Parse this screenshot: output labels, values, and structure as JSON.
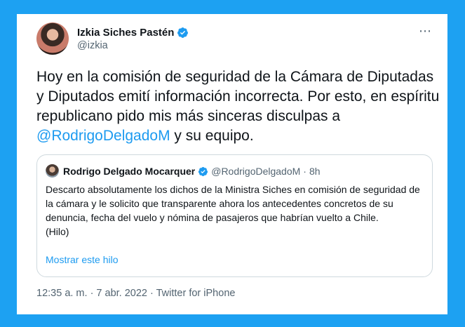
{
  "tweet": {
    "author": {
      "name": "Izkia Siches Pastén",
      "handle": "@izkia",
      "verified": true
    },
    "more_icon": "⋯",
    "text_parts": {
      "before": "Hoy en la comisión de seguridad de la Cámara de Diputadas y Diputados emití información incorrecta. Por esto, en espíritu republicano pido mis más sinceras disculpas a ",
      "mention": "@RodrigoDelgadoM",
      "after": " y su equipo."
    },
    "quoted": {
      "author": {
        "name": "Rodrigo Delgado Mocarquer",
        "handle": "@RodrigoDelgadoM",
        "verified": true
      },
      "separator": "·",
      "time": "8h",
      "text": "Descarto absolutamente los dichos de la Ministra Siches en comisión de seguridad de la cámara y le solicito que transparente ahora los antecedentes concretos de su denuncia, fecha del vuelo y nómina de pasajeros que habrían vuelto a Chile.",
      "text2": "(Hilo)",
      "show_thread": "Mostrar este hilo"
    },
    "meta": "12:35 a. m. · 7 abr. 2022 · Twitter for iPhone"
  },
  "colors": {
    "background": "#1da1f2",
    "verified": "#1d9bf0",
    "link": "#1d9bf0",
    "text": "#0f1419",
    "muted": "#536471"
  },
  "icons": {
    "verified": "verified-badge-icon",
    "more": "more-options-icon"
  }
}
